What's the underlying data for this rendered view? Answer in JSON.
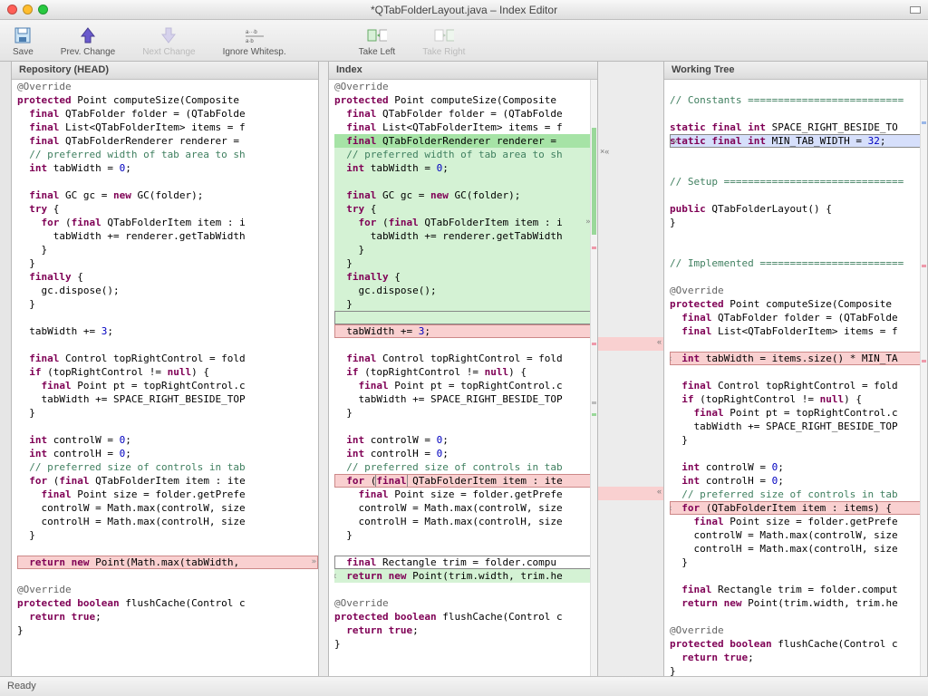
{
  "window": {
    "title": "*QTabFolderLayout.java – Index Editor"
  },
  "toolbar": {
    "save": "Save",
    "prev": "Prev. Change",
    "next": "Next Change",
    "ignore": "Ignore Whitesp.",
    "take_left": "Take Left",
    "take_right": "Take Right"
  },
  "panes": {
    "head": "Repository (HEAD)",
    "index": "Index",
    "work": "Working Tree"
  },
  "code_head": [
    {
      "t": "@Override",
      "cls": "an strike"
    },
    {
      "t": "protected Point computeSize(Composite ",
      "pre": "kw:protected"
    },
    {
      "t": "  final QTabFolder folder = (QTabFolde",
      "pre": "kw:final"
    },
    {
      "t": "  final List<QTabFolderItem> items = f",
      "pre": "kw:final"
    },
    {
      "t": "  final QTabFolderRenderer renderer = ",
      "pre": "kw:final"
    },
    {
      "t": "  // preferred width of tab area to sh",
      "cls": "cm"
    },
    {
      "t": "  int tabWidth = 0;",
      "pre": "kw:int",
      "num": "0"
    },
    {
      "t": ""
    },
    {
      "t": "  final GC gc = new GC(folder);",
      "pre": "kw:final",
      "kw2": "new"
    },
    {
      "t": "  try {",
      "pre": "kw:try"
    },
    {
      "t": "    for (final QTabFolderItem item : i",
      "pre": "kw:for",
      "kw2": "final"
    },
    {
      "t": "      tabWidth += renderer.getTabWidth"
    },
    {
      "t": "    }"
    },
    {
      "t": "  }"
    },
    {
      "t": "  finally {",
      "pre": "kw:finally"
    },
    {
      "t": "    gc.dispose();"
    },
    {
      "t": "  }"
    },
    {
      "t": ""
    },
    {
      "t": "  tabWidth += 3;",
      "num": "3"
    },
    {
      "t": ""
    },
    {
      "t": "  final Control topRightControl = fold",
      "pre": "kw:final"
    },
    {
      "t": "  if (topRightControl != null) {",
      "pre": "kw:if",
      "kw2": "null"
    },
    {
      "t": "    final Point pt = topRightControl.c",
      "pre": "kw:final"
    },
    {
      "t": "    tabWidth += SPACE_RIGHT_BESIDE_TOP"
    },
    {
      "t": "  }"
    },
    {
      "t": ""
    },
    {
      "t": "  int controlW = 0;",
      "pre": "kw:int",
      "num": "0"
    },
    {
      "t": "  int controlH = 0;",
      "pre": "kw:int",
      "num": "0"
    },
    {
      "t": "  // preferred size of controls in tab",
      "cls": "cm"
    },
    {
      "t": "  for (final QTabFolderItem item : ite",
      "pre": "kw:for",
      "kw2": "final"
    },
    {
      "t": "    final Point size = folder.getPrefe",
      "pre": "kw:final"
    },
    {
      "t": "    controlW = Math.max(controlW, size"
    },
    {
      "t": "    controlH = Math.max(controlH, size"
    },
    {
      "t": "  }"
    },
    {
      "t": ""
    },
    {
      "t": "  return new Point(Math.max(tabWidth, ",
      "pre": "kw:return",
      "kw2": "new",
      "hl": "red redbox",
      "mark": "»"
    },
    {
      "t": ""
    },
    {
      "t": "@Override",
      "cls": "an"
    },
    {
      "t": "protected boolean flushCache(Control c",
      "pre": "kw:protected",
      "kw2": "boolean"
    },
    {
      "t": "  return true;",
      "pre": "kw:return",
      "kw2": "true"
    },
    {
      "t": "}"
    }
  ],
  "code_index": [
    {
      "t": "@Override",
      "cls": "an strike"
    },
    {
      "t": "protected Point computeSize(Composite ",
      "pre": "kw:protected"
    },
    {
      "t": "  final QTabFolder folder = (QTabFolde",
      "pre": "kw:final"
    },
    {
      "t": "  final List<QTabFolderItem> items = f",
      "pre": "kw:final"
    },
    {
      "t": "  final QTabFolderRenderer renderer = ",
      "pre": "kw:final",
      "hl": "darkgreen"
    },
    {
      "t": "  // preferred width of tab area to sh",
      "cls": "cm",
      "hl": "green"
    },
    {
      "t": "  int tabWidth = 0;",
      "pre": "kw:int",
      "num": "0",
      "hl": "green"
    },
    {
      "t": "",
      "hl": "green"
    },
    {
      "t": "  final GC gc = new GC(folder);",
      "pre": "kw:final",
      "kw2": "new",
      "hl": "green"
    },
    {
      "t": "  try {",
      "pre": "kw:try",
      "hl": "green"
    },
    {
      "t": "    for (final QTabFolderItem item : i",
      "pre": "kw:for",
      "kw2": "final",
      "hl": "green",
      "mark": "»×"
    },
    {
      "t": "      tabWidth += renderer.getTabWidth",
      "hl": "green"
    },
    {
      "t": "    }",
      "hl": "green"
    },
    {
      "t": "  }",
      "hl": "green"
    },
    {
      "t": "  finally {",
      "pre": "kw:finally",
      "hl": "green"
    },
    {
      "t": "    gc.dispose();",
      "hl": "green"
    },
    {
      "t": "  }",
      "hl": "green"
    },
    {
      "t": "",
      "hl": "green box"
    },
    {
      "t": "  tabWidth += 3;",
      "num": "3",
      "hl": "red redbox",
      "mark": "»"
    },
    {
      "t": ""
    },
    {
      "t": "  final Control topRightControl = fold",
      "pre": "kw:final"
    },
    {
      "t": "  if (topRightControl != null) {",
      "pre": "kw:if",
      "kw2": "null"
    },
    {
      "t": "    final Point pt = topRightControl.c",
      "pre": "kw:final"
    },
    {
      "t": "    tabWidth += SPACE_RIGHT_BESIDE_TOP"
    },
    {
      "t": "  }"
    },
    {
      "t": ""
    },
    {
      "t": "  int controlW = 0;",
      "pre": "kw:int",
      "num": "0"
    },
    {
      "t": "  int controlH = 0;",
      "pre": "kw:int",
      "num": "0"
    },
    {
      "t": "  // preferred size of controls in tab",
      "cls": "cm"
    },
    {
      "t": "  for (final QTabFolderItem item : ite",
      "pre": "kw:for",
      "kw2": "final",
      "hl": "red redbox",
      "mark": "»",
      "boxword": "final"
    },
    {
      "t": "    final Point size = folder.getPrefe",
      "pre": "kw:final"
    },
    {
      "t": "    controlW = Math.max(controlW, size"
    },
    {
      "t": "    controlH = Math.max(controlH, size"
    },
    {
      "t": "  }"
    },
    {
      "t": ""
    },
    {
      "t": "  final Rectangle trim = folder.compu",
      "pre": "kw:final",
      "hl": "box",
      "mark": "▸"
    },
    {
      "t": "  return new Point(trim.width, trim.he",
      "pre": "kw:return",
      "kw2": "new",
      "hl": "green",
      "lmark": "×"
    },
    {
      "t": ""
    },
    {
      "t": "@Override",
      "cls": "an"
    },
    {
      "t": "protected boolean flushCache(Control c",
      "pre": "kw:protected",
      "kw2": "boolean"
    },
    {
      "t": "  return true;",
      "pre": "kw:return",
      "kw2": "true"
    },
    {
      "t": "}"
    }
  ],
  "code_work": [
    {
      "t": ""
    },
    {
      "t": "// Constants ==========================",
      "cls": "cm"
    },
    {
      "t": ""
    },
    {
      "t": "static final int SPACE_RIGHT_BESIDE_TO",
      "pre": "kw:static",
      "kw2": "final",
      "kw3": "int"
    },
    {
      "t": "static final int MIN_TAB_WIDTH = 32;",
      "pre": "kw:static",
      "kw2": "final",
      "kw3": "int",
      "num": "32",
      "hl": "blue box",
      "lmark": "×«"
    },
    {
      "t": ""
    },
    {
      "t": ""
    },
    {
      "t": "// Setup ==============================",
      "cls": "cm"
    },
    {
      "t": ""
    },
    {
      "t": "public QTabFolderLayout() {",
      "pre": "kw:public"
    },
    {
      "t": "}"
    },
    {
      "t": ""
    },
    {
      "t": ""
    },
    {
      "t": "// Implemented ========================",
      "cls": "cm"
    },
    {
      "t": ""
    },
    {
      "t": "@Override",
      "cls": "an"
    },
    {
      "t": "protected Point computeSize(Composite ",
      "pre": "kw:protected"
    },
    {
      "t": "  final QTabFolder folder = (QTabFolde",
      "pre": "kw:final"
    },
    {
      "t": "  final List<QTabFolderItem> items = f",
      "pre": "kw:final"
    },
    {
      "t": ""
    },
    {
      "t": "  int tabWidth = items.size() * MIN_TA",
      "pre": "kw:int",
      "hl": "red redbox",
      "lmark": "«"
    },
    {
      "t": ""
    },
    {
      "t": "  final Control topRightControl = fold",
      "pre": "kw:final"
    },
    {
      "t": "  if (topRightControl != null) {",
      "pre": "kw:if",
      "kw2": "null"
    },
    {
      "t": "    final Point pt = topRightControl.c",
      "pre": "kw:final"
    },
    {
      "t": "    tabWidth += SPACE_RIGHT_BESIDE_TOP"
    },
    {
      "t": "  }"
    },
    {
      "t": ""
    },
    {
      "t": "  int controlW = 0;",
      "pre": "kw:int",
      "num": "0"
    },
    {
      "t": "  int controlH = 0;",
      "pre": "kw:int",
      "num": "0"
    },
    {
      "t": "  // preferred size of controls in tab",
      "cls": "cm"
    },
    {
      "t": "  for (QTabFolderItem item : items) {",
      "pre": "kw:for",
      "hl": "red redbox",
      "lmark": "«"
    },
    {
      "t": "    final Point size = folder.getPrefe",
      "pre": "kw:final"
    },
    {
      "t": "    controlW = Math.max(controlW, size"
    },
    {
      "t": "    controlH = Math.max(controlH, size"
    },
    {
      "t": "  }"
    },
    {
      "t": ""
    },
    {
      "t": "  final Rectangle trim = folder.comput",
      "pre": "kw:final"
    },
    {
      "t": "  return new Point(trim.width, trim.he",
      "pre": "kw:return",
      "kw2": "new"
    },
    {
      "t": ""
    },
    {
      "t": "@Override",
      "cls": "an"
    },
    {
      "t": "protected boolean flushCache(Control c",
      "pre": "kw:protected",
      "kw2": "boolean"
    },
    {
      "t": "  return true;",
      "pre": "kw:return",
      "kw2": "true"
    },
    {
      "t": "}"
    }
  ],
  "status": "Ready"
}
